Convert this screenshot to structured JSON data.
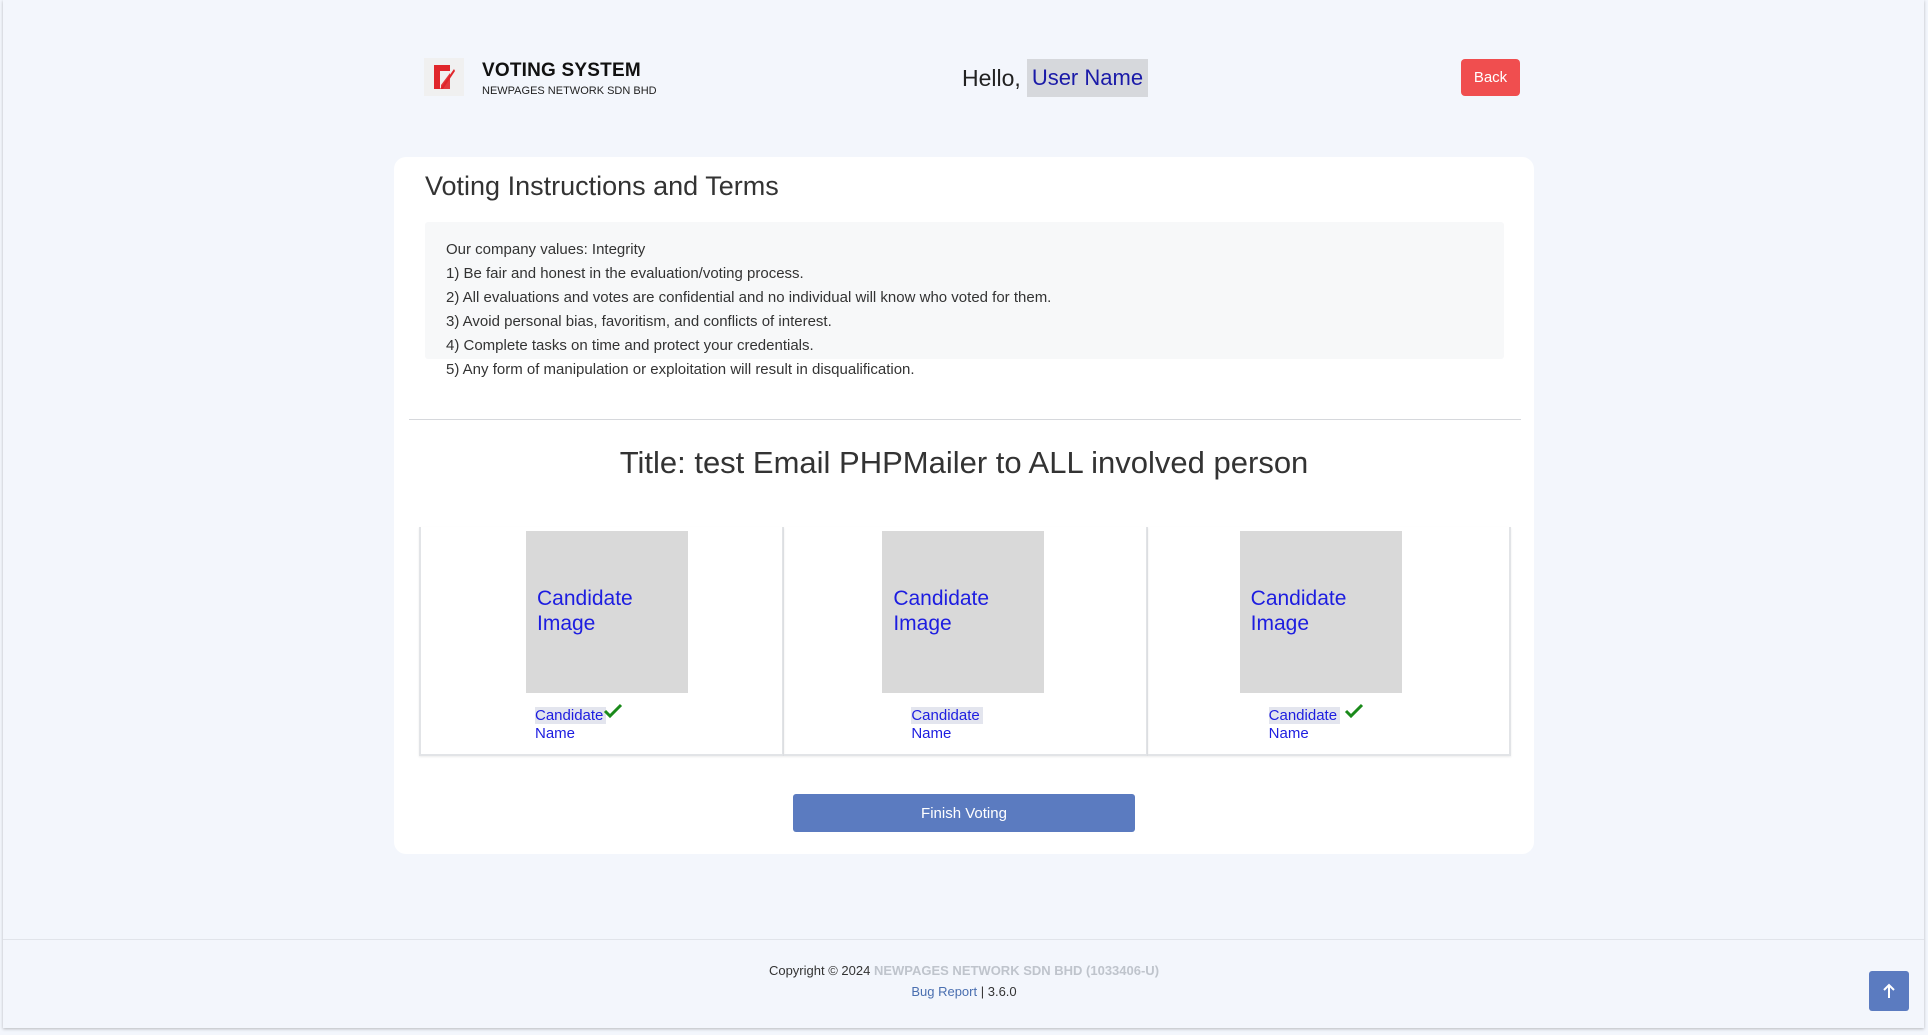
{
  "header": {
    "brand_title": "VOTING SYSTEM",
    "brand_subtitle": "NEWPAGES NETWORK SDN BHD",
    "hello_label": "Hello,",
    "user_name": "User Name",
    "back_label": "Back",
    "logo_icon": "newpages-logo-icon"
  },
  "instructions": {
    "title": "Voting Instructions and Terms",
    "lines": [
      "Our company values: Integrity",
      "1) Be fair and honest in the evaluation/voting process.",
      "2) All evaluations and votes are confidential and no individual will know who voted for them.",
      "3) Avoid personal bias, favoritism, and conflicts of interest.",
      "4) Complete tasks on time and protect your credentials.",
      "5) Any form of manipulation or exploitation will result in disqualification."
    ]
  },
  "vote": {
    "title": "Title: test Email PHPMailer to ALL involved person",
    "candidates": [
      {
        "image_label": "Candidate Image",
        "name_part1": "Candidate",
        "name_part2": "Name",
        "selected": true
      },
      {
        "image_label": "Candidate Image",
        "name_part1": "Candidate",
        "name_part2": "Name",
        "selected": false
      },
      {
        "image_label": "Candidate Image",
        "name_part1": "Candidate",
        "name_part2": "Name",
        "selected": true
      }
    ],
    "finish_label": "Finish Voting"
  },
  "footer": {
    "copyright": "Copyright © 2024",
    "company": "NEWPAGES NETWORK SDN BHD (1033406-U)",
    "bug_report": "Bug Report",
    "separator": "|",
    "version": "3.6.0"
  },
  "colors": {
    "back_button": "#f04e4f",
    "primary": "#5b7bc0",
    "candidate_text": "#1d1de0",
    "check": "#1a8a1a"
  }
}
